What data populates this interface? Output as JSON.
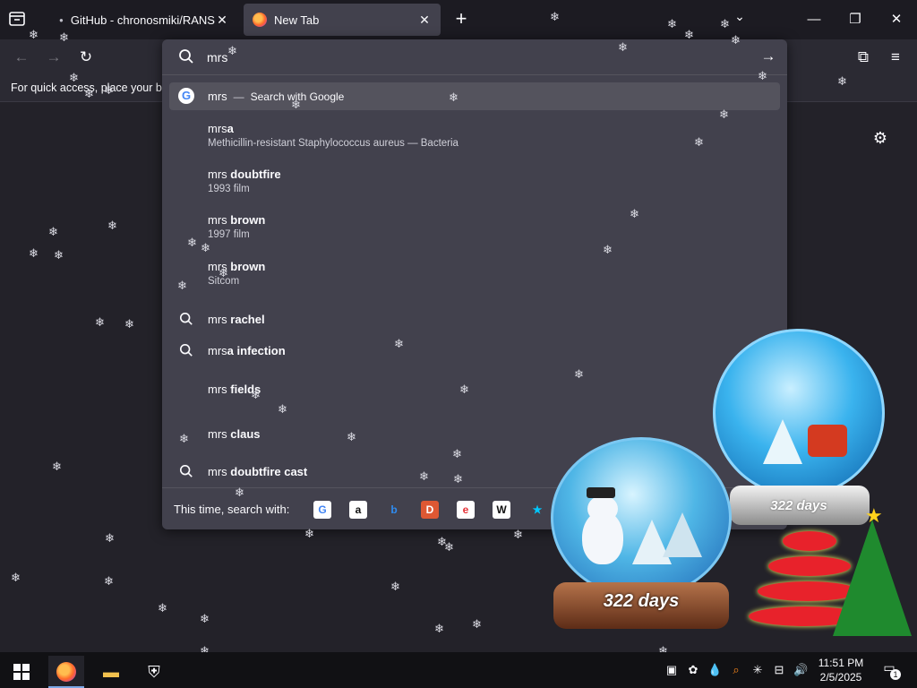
{
  "browser": {
    "tabs": [
      {
        "title": "GitHub - chronosmiki/RANSOM",
        "active": false
      },
      {
        "title": "New Tab",
        "active": true
      }
    ],
    "bookmarks_bar_text": "For quick access, place your bookmarks here on the bookmarks toolbar."
  },
  "urlbar": {
    "value": "mrs",
    "heuristic": {
      "typed": "mrs",
      "separator": "—",
      "action": "Search with Google"
    },
    "suggestions": [
      {
        "prefix": "mrs",
        "bold": "a",
        "sub": "Methicillin-resistant Staphylococcus aureus — Bacteria",
        "icon": ""
      },
      {
        "prefix": "mrs ",
        "bold": "doubtfire",
        "sub": "1993 film",
        "icon": ""
      },
      {
        "prefix": "mrs ",
        "bold": "brown",
        "sub": "1997 film",
        "icon": ""
      },
      {
        "prefix": "mrs ",
        "bold": "brown",
        "sub": "Sitcom",
        "icon": ""
      },
      {
        "prefix": "mrs ",
        "bold": "rachel",
        "sub": "",
        "icon": "search-icon"
      },
      {
        "prefix": "mrs",
        "bold": "a infection",
        "sub": "",
        "icon": "search-icon"
      },
      {
        "prefix": "mrs ",
        "bold": "fields",
        "sub": "",
        "icon": ""
      },
      {
        "prefix": "mrs ",
        "bold": "claus",
        "sub": "",
        "icon": ""
      },
      {
        "prefix": "mrs ",
        "bold": "doubtfire cast",
        "sub": "",
        "icon": "search-icon"
      }
    ],
    "one_off_label": "This time, search with:",
    "engines": [
      {
        "name": "google",
        "glyph": "G",
        "bg": "#ffffff",
        "fg": "#4285f4"
      },
      {
        "name": "amazon",
        "glyph": "a",
        "bg": "#ffffff",
        "fg": "#111111"
      },
      {
        "name": "bing",
        "glyph": "b",
        "bg": "transparent",
        "fg": "#2f8cf0"
      },
      {
        "name": "duckduckgo",
        "glyph": "D",
        "bg": "#de5833",
        "fg": "#ffffff"
      },
      {
        "name": "ebay",
        "glyph": "e",
        "bg": "#ffffff",
        "fg": "#e53238"
      },
      {
        "name": "wikipedia",
        "glyph": "W",
        "bg": "#ffffff",
        "fg": "#111111"
      },
      {
        "name": "bookmarks",
        "glyph": "★",
        "bg": "transparent",
        "fg": "#00c8ff"
      }
    ]
  },
  "widgets": {
    "globe_left_text": "322 days",
    "globe_right_text": "322 days"
  },
  "taskbar": {
    "time": "11:51 PM",
    "date": "2/5/2025",
    "notification_count": "1"
  }
}
